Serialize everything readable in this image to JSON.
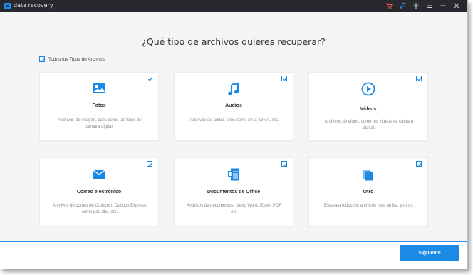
{
  "app": {
    "title": "data recovery"
  },
  "titlebar": {
    "icons": [
      "cart-icon",
      "key-icon",
      "plus-icon",
      "menu-icon",
      "minimize-icon",
      "close-icon"
    ]
  },
  "main": {
    "heading": "¿Qué tipo de archivos quieres recuperar?",
    "all_types": {
      "label": "Todos los Tipos de Archivos",
      "checked": true
    },
    "cards": [
      {
        "title": "Fotos",
        "icon": "photo-icon",
        "checked": true,
        "description": "Archivos de imagen, tales como las fotos de cámara digital."
      },
      {
        "title": "Audios",
        "icon": "music-note-icon",
        "checked": true,
        "description": "Archivos de audio, tales como MP3, WMA, etc."
      },
      {
        "title": "Vídeos",
        "icon": "play-icon",
        "checked": true,
        "description": "Archivos de vídeo, como  los vídeos de cámara digital."
      },
      {
        "title": "Correo electrónico",
        "icon": "email-icon",
        "checked": true,
        "description": "Archivos de correo de Outlook o Outlook Express, como pst, dbx, etc."
      },
      {
        "title": "Documentos de Office",
        "icon": "document-icon",
        "checked": true,
        "description": "Archivos de documentos, como Word, Excel, PDF, etc."
      },
      {
        "title": "Otro",
        "icon": "files-icon",
        "checked": true,
        "description": "Escanea todos los archivos más arriba, y otros."
      }
    ]
  },
  "footer": {
    "next_label": "Siguiente"
  },
  "colors": {
    "accent": "#1b8ae6",
    "titlebar": "#28292f",
    "cart": "#e8554e",
    "key": "#3a9bf0"
  }
}
